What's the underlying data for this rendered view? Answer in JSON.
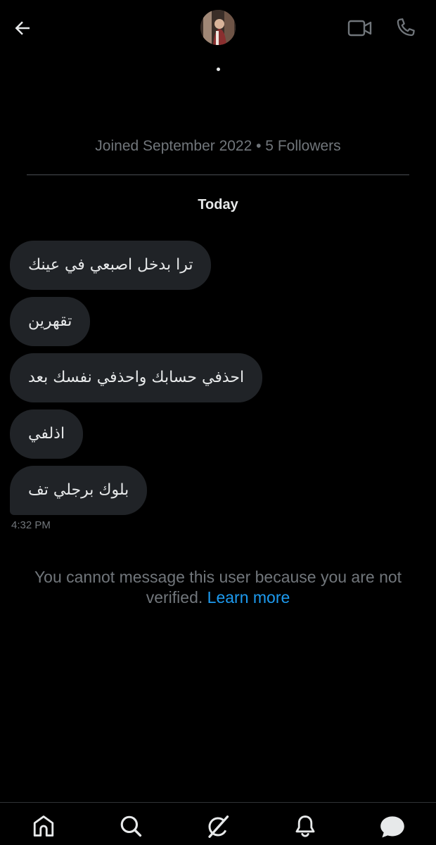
{
  "profile": {
    "meta": "Joined September 2022 • 5 Followers"
  },
  "conversation": {
    "day_label": "Today",
    "messages": [
      {
        "text": "ترا بدخل اصبعي في عينك"
      },
      {
        "text": "تقهرين"
      },
      {
        "text": "احذفي حسابك واحذفي نفسك بعد"
      },
      {
        "text": "اذلفي"
      },
      {
        "text": "بلوك برجلي تف"
      }
    ],
    "last_timestamp": "4:32 PM"
  },
  "notice": {
    "text": "You cannot message this user because you are not verified.",
    "link_label": "Learn more"
  },
  "icons": {
    "back": "arrow-left-icon",
    "video": "video-camera-icon",
    "call": "phone-icon",
    "home": "home-icon",
    "search": "search-icon",
    "grok": "grok-icon",
    "notifications": "bell-icon",
    "messages": "message-bubble-icon"
  },
  "colors": {
    "background": "#000000",
    "bubble": "#202327",
    "secondary_text": "#71767b",
    "link": "#1d9bf0"
  }
}
